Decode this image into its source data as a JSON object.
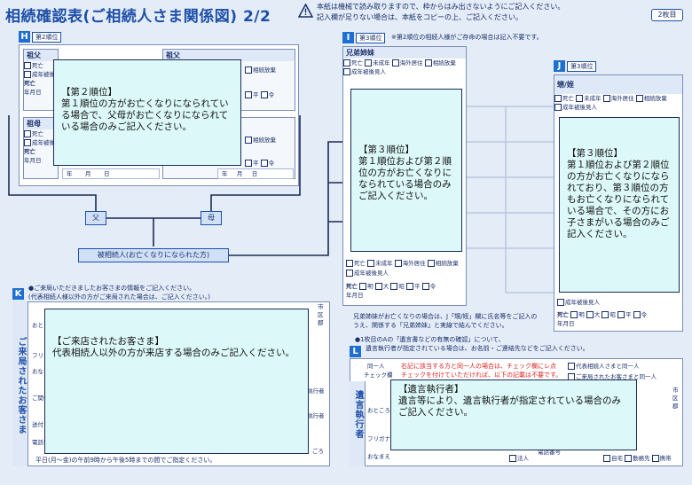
{
  "header": {
    "title": "相続確認表(ご相続人さま関係図) 2/2",
    "notice_line1": "本紙は機械で読み取りますので、枠からはみ出さないようにご記入ください。",
    "notice_line2": "記入欄が足りない場合は、本紙をコピーの上、ご記入ください。",
    "page_badge": "2枚目"
  },
  "section_h": {
    "label": "H",
    "rank": "第2順位",
    "father": "祖父",
    "father2": "祖父",
    "mother": "祖母",
    "deceased": "死亡",
    "guardian": "成年被後見人",
    "renounce": "相続放棄",
    "death_date": "死亡",
    "ymd": "年月日",
    "era_heisei": "平",
    "era_reiwa": "令",
    "year": "年",
    "month": "月",
    "day": "日",
    "overlay_title": "【第２順位】",
    "overlay_body": "第１順位の方がお亡くなりになられている場合で、父母がお亡くなりになられている場合のみご記入ください。"
  },
  "tags": {
    "father": "父",
    "mother": "母",
    "decedent": "被相続人(お亡くなりになられた方)"
  },
  "section_i": {
    "label": "I",
    "rank": "第3順位",
    "note": "※第2順位の相続人様がご存命の場合は記入不要です。",
    "head": "兄弟姉妹",
    "deceased": "死亡",
    "not_deceased": "未成年",
    "overseas": "海外居住",
    "renounce": "相続放棄",
    "guardian": "成年被後見人",
    "death_date": "死亡",
    "ymd": "年月日",
    "era_meiji": "明",
    "era_taisho": "大",
    "era_showa": "昭",
    "era_heisei": "平",
    "era_reiwa": "令",
    "overlay_title": "【第３順位】",
    "overlay_body": "第１順位および第２順位の方がお亡くなりになられている場合のみご記入ください。",
    "footnote1": "兄弟姉妹がお亡くなりの場合は、J「甥/姪」欄に氏名等をご記入の",
    "footnote2": "うえ、関係する「兄弟姉妹」と実線で結んでください。"
  },
  "section_j": {
    "label": "J",
    "rank": "第3順位",
    "head": "甥/姪",
    "deceased": "死亡",
    "minor": "未成年",
    "overseas": "海外居住",
    "renounce": "相続放棄",
    "guardian": "成年被後見人",
    "death_date": "死亡",
    "ymd": "年月日",
    "era_meiji": "明",
    "era_taisho": "大",
    "era_showa": "昭",
    "era_heisei": "平",
    "era_reiwa": "令",
    "overlay_title": "【第３順位】",
    "overlay_body": "第１順位および第２順位の方がお亡くなりになられており、第３順位の方もお亡くなりになられている場合で、その方にお子さまがいる場合のみご記入ください。"
  },
  "section_k": {
    "label": "K",
    "intro1": "●ご来局いただきましたお客さまの情報をご記入ください。",
    "intro2": "(代表相続人様以外の方がご来局された場合は、ご記入ください。)",
    "vertical_label": "ご来局されたお客さま",
    "field_address": "おところ",
    "field_furigana": "フリガナ",
    "field_name": "おなまえ",
    "field_relation": "ご関係",
    "field_send": "送付",
    "field_phone": "電話番号",
    "prefecture": "都道",
    "city": "市区郡",
    "executor": "執行者",
    "executor2": "執行者",
    "tail": "ごろ",
    "hours": "平日(月～金)の午前9時から午後5時までの間でご指定ください。",
    "overlay_title": "【ご来店されたお客さま】",
    "overlay_body": "代表相続人以外の方が来店する場合のみご記入ください。"
  },
  "section_l": {
    "label": "L",
    "intro1": "●1枚目のAの「遺言書などの有無の確認」について、",
    "intro2": "遺言執行者が指定されている場合は、お名前・ご連絡先などをご記入ください。",
    "vertical_label": "遺言執行者",
    "same_person": "同一人",
    "check": "チェック欄",
    "same_note1": "右記に該当する方と同一人の場合は、チェック欄にレ点",
    "same_note2": "チェックを付けていただければ、以下の記載は不要です。",
    "same_rep": "代表相続人さまと同一人",
    "same_visitor": "ご来局されたお客さまと同一人",
    "field_address": "おところ",
    "field_furigana": "フリガナ",
    "field_name": "おなまえ",
    "corporation": "法人",
    "phone": "電話番号",
    "home": "自宅",
    "work": "勤務先",
    "mobile": "携帯",
    "city": "市区郡",
    "overlay_title": "【遺言執行者】",
    "overlay_body": "遺言等により、遺言執行者が指定されている場合のみご記入ください。"
  }
}
